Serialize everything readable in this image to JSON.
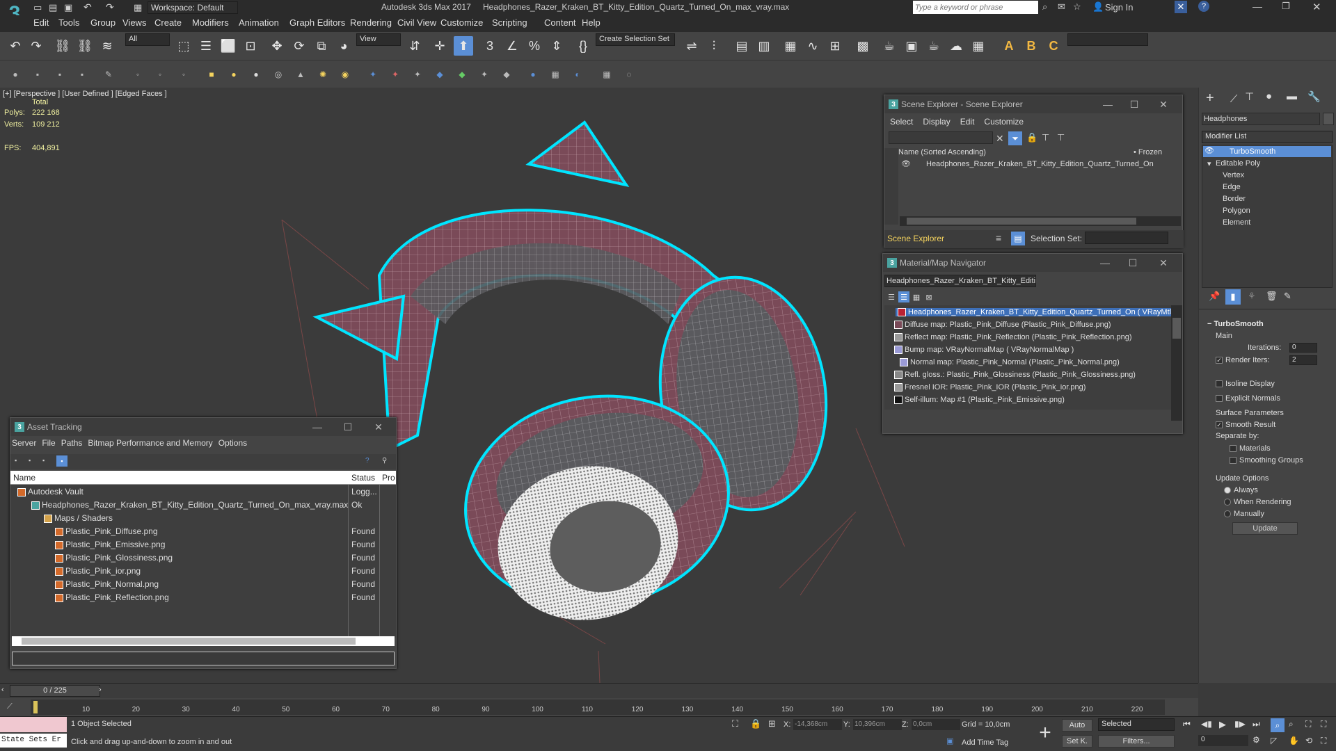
{
  "app": {
    "title": "Autodesk 3ds Max 2017",
    "filename": "Headphones_Razer_Kraken_BT_Kitty_Edition_Quartz_Turned_On_max_vray.max",
    "workspace": "Workspace: Default",
    "search_placeholder": "Type a keyword or phrase",
    "sign_in": "Sign In"
  },
  "menus": [
    "Edit",
    "Tools",
    "Group",
    "Views",
    "Create",
    "Modifiers",
    "Animation",
    "Graph Editors",
    "Rendering",
    "Civil View",
    "Customize",
    "Scripting",
    "Content",
    "Help"
  ],
  "toolbar": {
    "filter": "All",
    "refcoord": "View",
    "selection_set": "Create Selection Set"
  },
  "viewport": {
    "label": "[+] [Perspective ] [User Defined ] [Edged Faces ]",
    "total_label": "Total",
    "polys_label": "Polys:",
    "polys_value": "222 168",
    "verts_label": "Verts:",
    "verts_value": "109 212",
    "fps_label": "FPS:",
    "fps_value": "404,891"
  },
  "scene_explorer": {
    "title": "Scene Explorer - Scene Explorer",
    "menus": [
      "Select",
      "Display",
      "Edit",
      "Customize"
    ],
    "column": "Name (Sorted Ascending)",
    "frozen": "• Frozen",
    "item": "Headphones_Razer_Kraken_BT_Kitty_Edition_Quartz_Turned_On",
    "footer_name": "Scene Explorer",
    "selection_set_label": "Selection Set:"
  },
  "material_nav": {
    "title": "Material/Map Navigator",
    "field": "Headphones_Razer_Kraken_BT_Kitty_Edition_",
    "root": "Headphones_Razer_Kraken_BT_Kitty_Edition_Quartz_Turned_On  ( VRayMtl )",
    "items": [
      "Diffuse map: Plastic_Pink_Diffuse (Plastic_Pink_Diffuse.png)",
      "Reflect map: Plastic_Pink_Reflection (Plastic_Pink_Reflection.png)",
      "Bump map: VRayNormalMap  ( VRayNormalMap )",
      "Normal map: Plastic_Pink_Normal (Plastic_Pink_Normal.png)",
      "Refl. gloss.: Plastic_Pink_Glossiness (Plastic_Pink_Glossiness.png)",
      "Fresnel IOR: Plastic_Pink_IOR (Plastic_Pink_ior.png)",
      "Self-illum: Map #1 (Plastic_Pink_Emissive.png)"
    ]
  },
  "asset_tracking": {
    "title": "Asset Tracking",
    "menus": [
      "Server",
      "File",
      "Paths",
      "Bitmap Performance and Memory",
      "Options"
    ],
    "col_name": "Name",
    "col_status": "Status",
    "col_pro": "Pro",
    "rows": [
      {
        "name": "Autodesk Vault",
        "status": "Logg..."
      },
      {
        "name": "Headphones_Razer_Kraken_BT_Kitty_Edition_Quartz_Turned_On_max_vray.max",
        "status": "Ok"
      },
      {
        "name": "Maps / Shaders",
        "status": ""
      },
      {
        "name": "Plastic_Pink_Diffuse.png",
        "status": "Found"
      },
      {
        "name": "Plastic_Pink_Emissive.png",
        "status": "Found"
      },
      {
        "name": "Plastic_Pink_Glossiness.png",
        "status": "Found"
      },
      {
        "name": "Plastic_Pink_ior.png",
        "status": "Found"
      },
      {
        "name": "Plastic_Pink_Normal.png",
        "status": "Found"
      },
      {
        "name": "Plastic_Pink_Reflection.png",
        "status": "Found"
      }
    ]
  },
  "command_panel": {
    "object_name": "Headphones",
    "modifier_list": "Modifier List",
    "stack": [
      "TurboSmooth",
      "Editable Poly",
      "Vertex",
      "Edge",
      "Border",
      "Polygon",
      "Element"
    ],
    "rollout_title": "TurboSmooth",
    "main": "Main",
    "iterations_label": "Iterations:",
    "iterations_value": "0",
    "render_iters_label": "Render Iters:",
    "render_iters_value": "2",
    "isoline": "Isoline Display",
    "explicit": "Explicit Normals",
    "surface_params": "Surface Parameters",
    "smooth_result": "Smooth Result",
    "separate_by": "Separate by:",
    "materials": "Materials",
    "smoothing_groups": "Smoothing Groups",
    "update_options": "Update Options",
    "always": "Always",
    "when_rendering": "When Rendering",
    "manually": "Manually",
    "update_button": "Update"
  },
  "timeline": {
    "frame": "0 / 225",
    "ticks": [
      "10",
      "20",
      "30",
      "40",
      "50",
      "60",
      "70",
      "80",
      "90",
      "100",
      "110",
      "120",
      "130",
      "140",
      "150",
      "160",
      "170",
      "180",
      "190",
      "200",
      "210",
      "220"
    ]
  },
  "status": {
    "state_sets": "State Sets Er",
    "selected": "1 Object Selected",
    "hint": "Click and drag up-and-down to zoom in and out",
    "x_label": "X:",
    "x_value": "-14,368cm",
    "y_label": "Y:",
    "y_value": "10,396cm",
    "z_label": "Z:",
    "z_value": "0,0cm",
    "grid": "Grid = 10,0cm",
    "add_time_tag": "Add Time Tag",
    "auto": "Auto",
    "selected_dd": "Selected",
    "setk": "Set K.",
    "filters": "Filters...",
    "frame_field": "0"
  },
  "colors": {
    "accent": "#5b8fd6",
    "selection": "#00e5ff",
    "headphone": "#7a4a58"
  }
}
